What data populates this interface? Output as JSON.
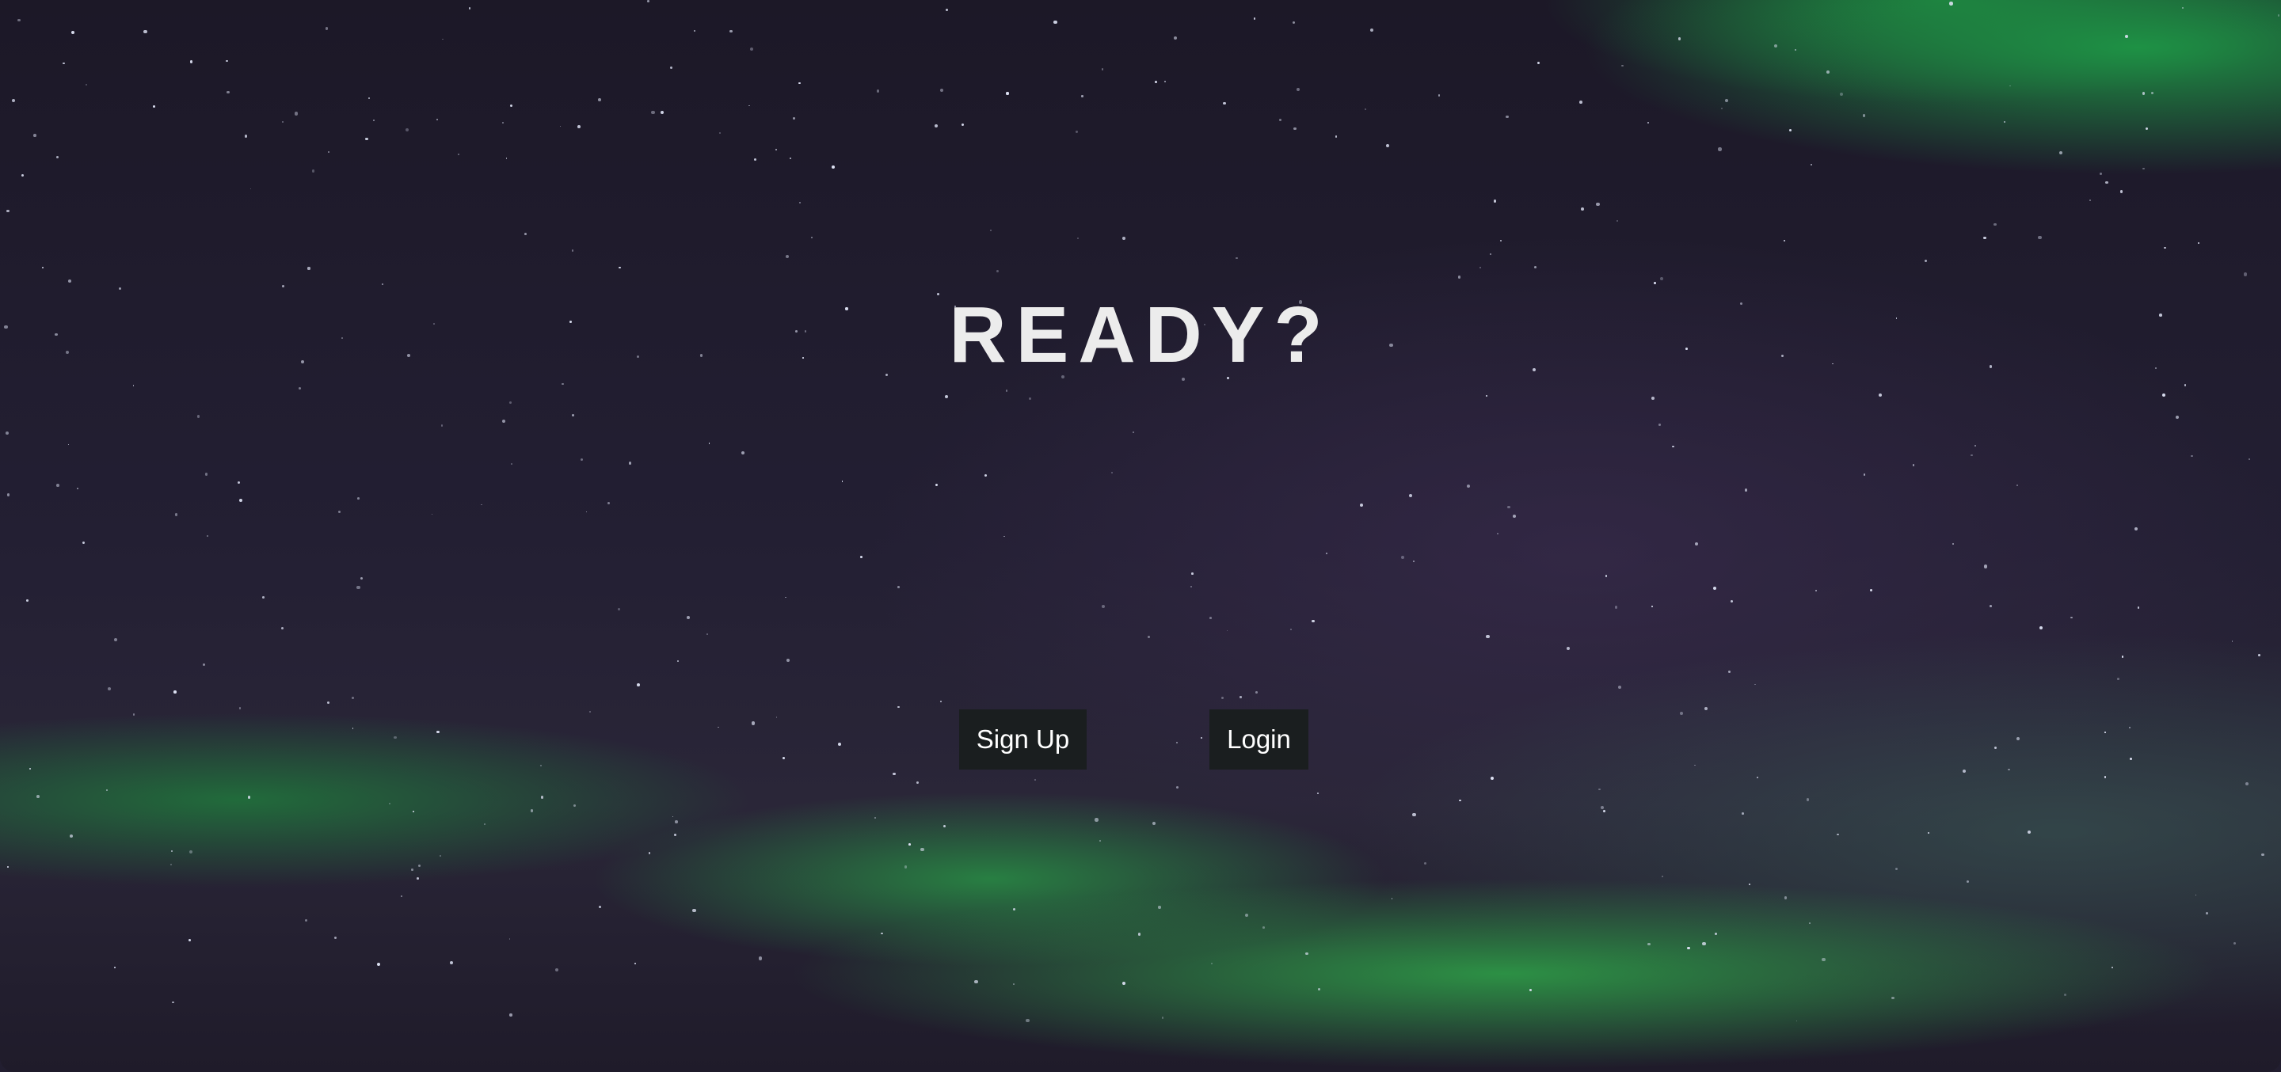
{
  "hero": {
    "title": "READY?"
  },
  "actions": {
    "signup_label": "Sign Up",
    "login_label": "Login"
  },
  "colors": {
    "button_bg": "#1a1e1f",
    "title": "#ececec",
    "aurora": "#2e9a4a"
  }
}
